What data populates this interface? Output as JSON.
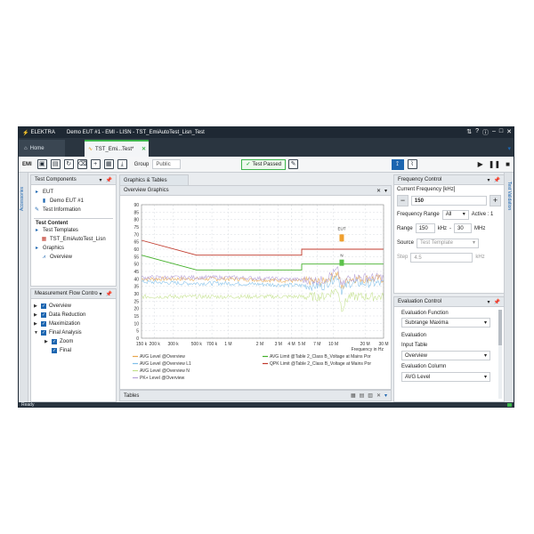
{
  "app": {
    "brand": "ELEKTRA",
    "title": "Demo EUT #1 - EMI - LISN - TST_EmiAutoTest_Lisn_Test"
  },
  "tabs": {
    "home": "Home",
    "document": "TST_Emi...Test*"
  },
  "toolbar": {
    "mode": "EMI",
    "group_label": "Group",
    "group_value": "Public",
    "status": "Test Passed"
  },
  "left_strip": {
    "label": "Accessories"
  },
  "right_strip": {
    "label": "Test Validation"
  },
  "test_components": {
    "title": "Test Components",
    "eut_section": "EUT",
    "eut_item": "Demo EUT #1",
    "test_info": "Test Information",
    "content_section": "Test Content",
    "templates": "Test Templates",
    "template_item": "TST_EmiAutoTest_Lisn",
    "graphics": "Graphics",
    "overview": "Overview"
  },
  "flow_control": {
    "title": "Measurement Flow Contro",
    "items": [
      {
        "label": "Overview",
        "level": 0
      },
      {
        "label": "Data Reduction",
        "level": 0
      },
      {
        "label": "Maximization",
        "level": 0
      },
      {
        "label": "Final Analysis",
        "level": 0
      },
      {
        "label": "Zoom",
        "level": 1
      },
      {
        "label": "Final",
        "level": 1
      }
    ]
  },
  "center": {
    "tab": "Graphics & Tables",
    "panel_title": "Overview Graphics",
    "tables": "Tables"
  },
  "chart_data": {
    "type": "line",
    "title": "",
    "xlabel": "Frequency in Hz",
    "ylabel": "",
    "x_scale": "log",
    "xlim": [
      150000,
      30000000
    ],
    "ylim": [
      0,
      90
    ],
    "y_ticks": [
      "90",
      "85",
      "80",
      "75",
      "70",
      "65",
      "60",
      "55",
      "50",
      "45",
      "40",
      "35",
      "30",
      "25",
      "20",
      "15",
      "10",
      "5",
      "0"
    ],
    "x_ticks": [
      {
        "label": "150 k",
        "value": 150000
      },
      {
        "label": "200 k",
        "value": 200000
      },
      {
        "label": "300 k",
        "value": 300000
      },
      {
        "label": "500 k",
        "value": 500000
      },
      {
        "label": "700 k",
        "value": 700000
      },
      {
        "label": "1 M",
        "value": 1000000
      },
      {
        "label": "2 M",
        "value": 2000000
      },
      {
        "label": "3 M",
        "value": 3000000
      },
      {
        "label": "4 M",
        "value": 4000000
      },
      {
        "label": "5 M",
        "value": 5000000
      },
      {
        "label": "7 M",
        "value": 7000000
      },
      {
        "label": "10 M",
        "value": 10000000
      },
      {
        "label": "20 M",
        "value": 20000000
      },
      {
        "label": "30 M",
        "value": 30000000
      }
    ],
    "grid": true,
    "series": [
      {
        "name": "AVG Level @Overview",
        "color": "#e8a64c",
        "kind": "noise",
        "x": [
          150000,
          400000,
          1000000,
          3000000,
          8000000,
          11000000,
          12000000,
          14000000,
          30000000
        ],
        "y": [
          40,
          40,
          40,
          39,
          38,
          44,
          34,
          40,
          40
        ]
      },
      {
        "name": "AVG Level @Overview L1",
        "color": "#7fbfe9",
        "kind": "noise",
        "x": [
          150000,
          400000,
          1000000,
          3000000,
          8000000,
          11000000,
          12000000,
          14000000,
          30000000
        ],
        "y": [
          38,
          37,
          37,
          36,
          35,
          42,
          32,
          37,
          37
        ]
      },
      {
        "name": "AVG Level @Overview N",
        "color": "#c2e08a",
        "kind": "noise",
        "x": [
          150000,
          400000,
          1000000,
          3000000,
          8000000,
          11000000,
          12000000,
          14000000,
          30000000
        ],
        "y": [
          28,
          28,
          28,
          28,
          28,
          33,
          20,
          28,
          28
        ]
      },
      {
        "name": "PK+ Level @Overview",
        "color": "#b5a0d8",
        "kind": "noise",
        "x": [
          150000,
          400000,
          1000000,
          3000000,
          8000000,
          11000000,
          12000000,
          14000000,
          30000000
        ],
        "y": [
          41,
          41,
          41,
          40,
          39,
          46,
          35,
          41,
          41
        ]
      },
      {
        "name": "AVG Limit @Table 2_Class B_Voltage at Mains Por",
        "color": "#43b02a",
        "kind": "limit",
        "x": [
          150000,
          500000,
          500000,
          5000000,
          5000000,
          30000000
        ],
        "y": [
          56,
          46,
          46,
          46,
          50,
          50
        ]
      },
      {
        "name": "QPK Limit @Table 2_Class B_Voltage at Mains Por",
        "color": "#c0392b",
        "kind": "limit",
        "x": [
          150000,
          500000,
          500000,
          5000000,
          5000000,
          30000000
        ],
        "y": [
          66,
          56,
          56,
          56,
          60,
          60
        ]
      }
    ],
    "annotations": [
      {
        "text": "EUT",
        "x": 12000000,
        "y": 73
      },
      {
        "text": "N",
        "x": 12000000,
        "y": 55
      }
    ]
  },
  "freq_control": {
    "title": "Frequency Control",
    "current_label": "Current Frequency [kHz]",
    "current_value": "150",
    "range_label": "Frequency Range",
    "range_value": "All",
    "active": "Active : 1",
    "range_label2": "Range",
    "range_from": "150",
    "range_unit1": "kHz",
    "range_sep": "-",
    "range_to": "30",
    "range_unit2": "MHz",
    "source_label": "Source",
    "source_value": "Test Template",
    "step_label": "Step",
    "step_value": "4.5",
    "step_unit": "kHz"
  },
  "eval_control": {
    "title": "Evaluation Control",
    "function_label": "Evaluation Function",
    "function_value": "Subrange Maxima",
    "eval_label": "Evaluation",
    "input_label": "Input Table",
    "input_value": "Overview",
    "column_label": "Evaluation Column",
    "column_value": "AVG Level"
  },
  "statusbar": {
    "text": "Ready"
  },
  "colors": {
    "accent": "#1b65b0",
    "success": "#3cb44b",
    "titlebar": "#1e2833"
  }
}
